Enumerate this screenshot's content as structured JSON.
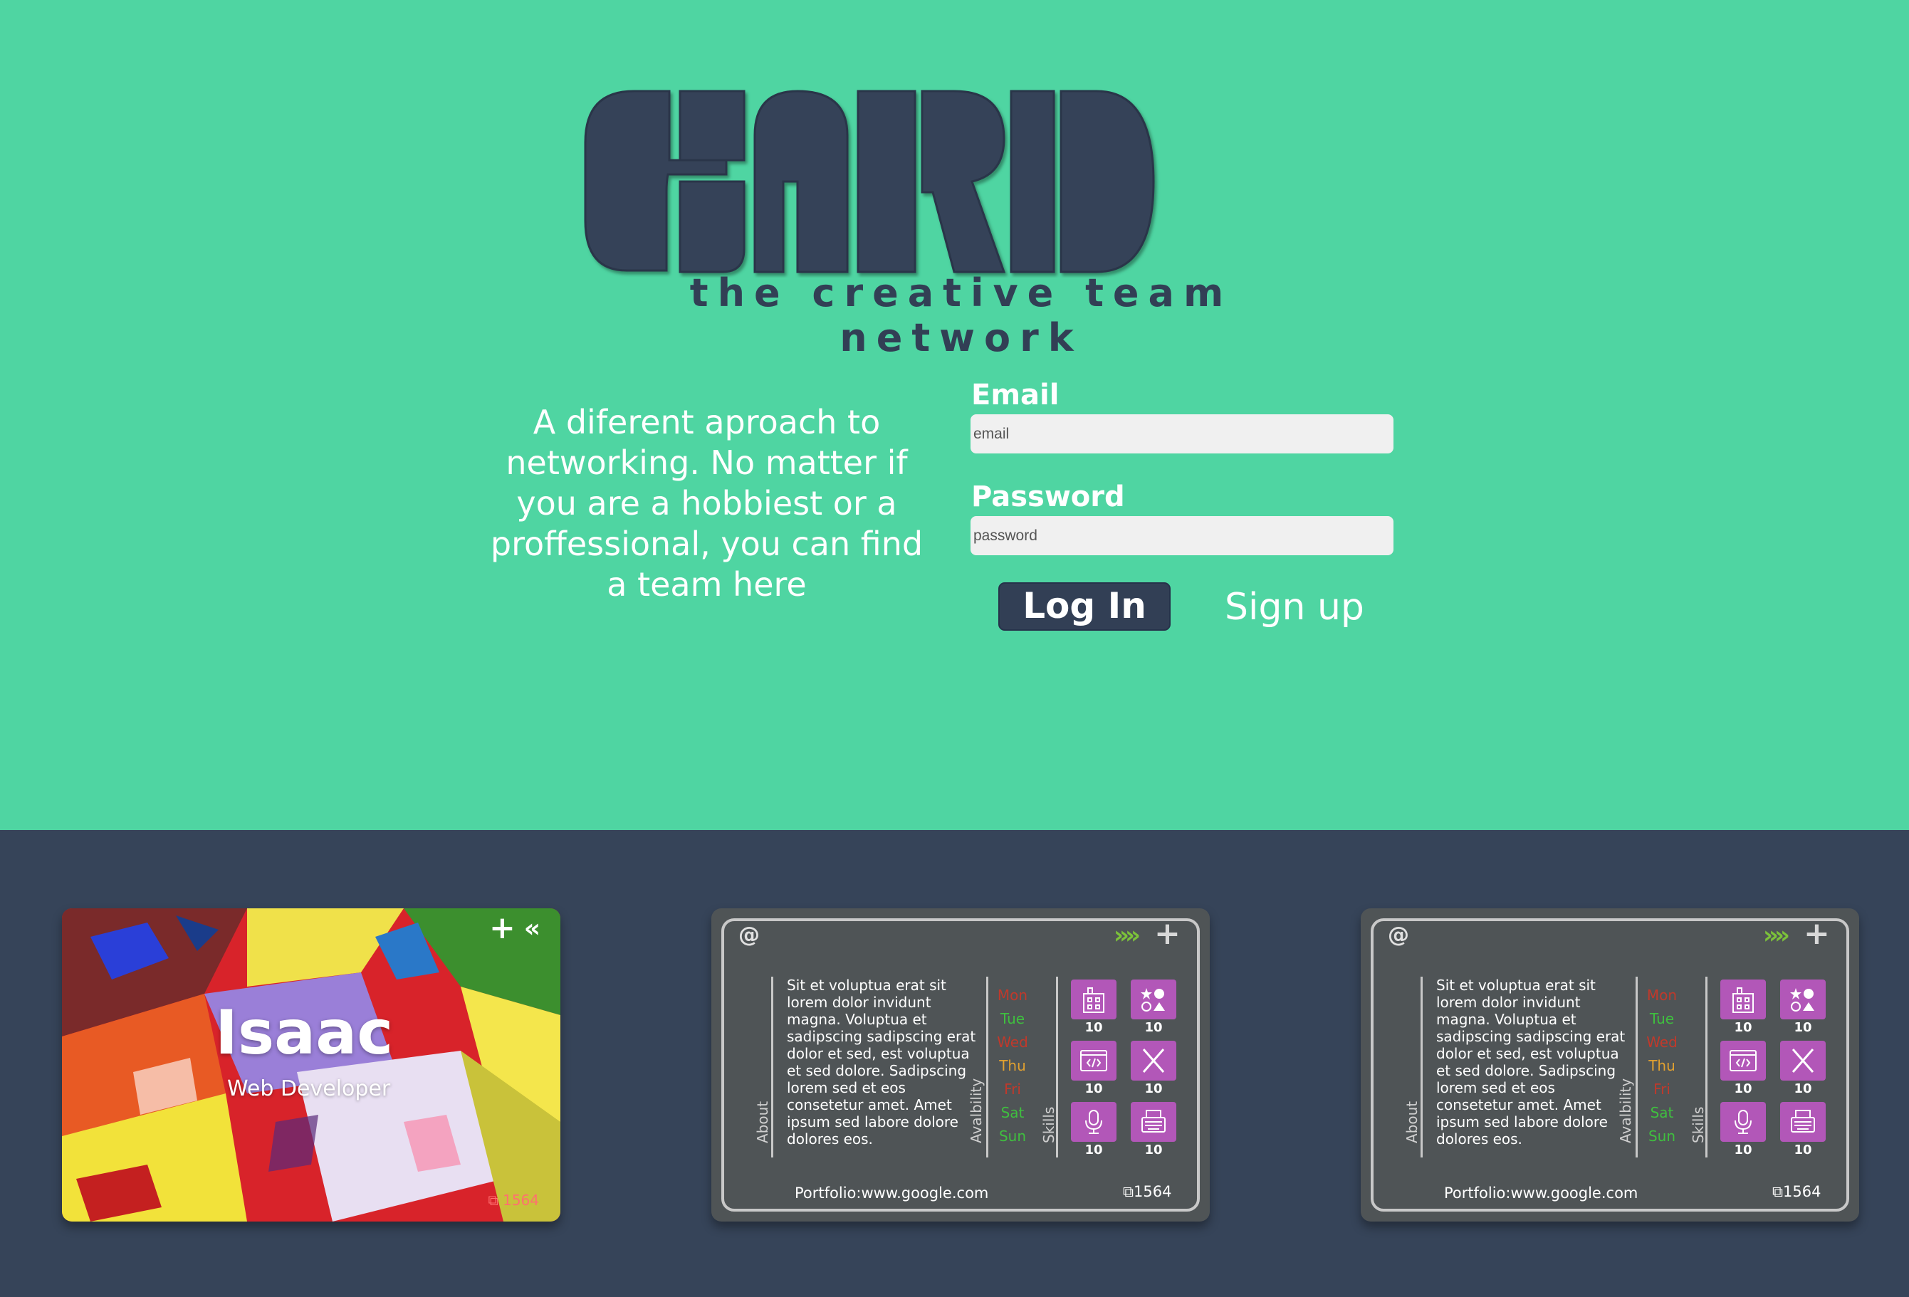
{
  "brand": {
    "logo_text": "CARD",
    "tagline": "the creative team network"
  },
  "intro": {
    "text": "A diferent aproach to networking. No matter if you are a hobbiest or a proffessional, you can find a team here"
  },
  "login": {
    "email_label": "Email",
    "email_placeholder": "email",
    "password_label": "Password",
    "password_placeholder": "password",
    "login_button": "Log In",
    "signup_link": "Sign up"
  },
  "colors": {
    "mint": "#4fd5a2",
    "navy": "#323f55",
    "card_back": "#4f5456",
    "skill_purple": "#b257b8",
    "arrow_green": "#7cc23a"
  },
  "front_card": {
    "name": "Isaac",
    "role": "Web Developer",
    "count": "1564",
    "icons": [
      "chevrons-left-icon",
      "plus-icon"
    ]
  },
  "back_cards": [
    {
      "at_symbol": "@",
      "about_label": "About",
      "about_text": "Sit et voluptua erat sit lorem dolor invidunt magna. Voluptua et sadipscing sadipscing erat dolor et sed, est voluptua et sed dolore. Sadipscing lorem sed et eos consetetur amet. Amet ipsum sed labore dolore dolores eos.",
      "availability_label": "Avalbility",
      "days": [
        {
          "label": "Mon",
          "color": "#c0392b"
        },
        {
          "label": "Tue",
          "color": "#3fbf3f"
        },
        {
          "label": "Wed",
          "color": "#c0392b"
        },
        {
          "label": "Thu",
          "color": "#e0a030"
        },
        {
          "label": "Fri",
          "color": "#c0392b"
        },
        {
          "label": "Sat",
          "color": "#3fbf3f"
        },
        {
          "label": "Sun",
          "color": "#3fbf3f"
        }
      ],
      "skills_label": "Skills",
      "skills": [
        {
          "icon": "building-icon",
          "value": "10"
        },
        {
          "icon": "shapes-icon",
          "value": "10"
        },
        {
          "icon": "code-window-icon",
          "value": "10"
        },
        {
          "icon": "crossed-tools-icon",
          "value": "10"
        },
        {
          "icon": "microphone-icon",
          "value": "10"
        },
        {
          "icon": "typewriter-icon",
          "value": "10"
        }
      ],
      "portfolio": "Portfolio:www.google.com",
      "count": "1564"
    },
    {
      "at_symbol": "@",
      "about_label": "About",
      "about_text": "Sit et voluptua erat sit lorem dolor invidunt magna. Voluptua et sadipscing sadipscing erat dolor et sed, est voluptua et sed dolore. Sadipscing lorem sed et eos consetetur amet. Amet ipsum sed labore dolore dolores eos.",
      "availability_label": "Avalbility",
      "days": [
        {
          "label": "Mon",
          "color": "#c0392b"
        },
        {
          "label": "Tue",
          "color": "#3fbf3f"
        },
        {
          "label": "Wed",
          "color": "#c0392b"
        },
        {
          "label": "Thu",
          "color": "#e0a030"
        },
        {
          "label": "Fri",
          "color": "#c0392b"
        },
        {
          "label": "Sat",
          "color": "#3fbf3f"
        },
        {
          "label": "Sun",
          "color": "#3fbf3f"
        }
      ],
      "skills_label": "Skills",
      "skills": [
        {
          "icon": "building-icon",
          "value": "10"
        },
        {
          "icon": "shapes-icon",
          "value": "10"
        },
        {
          "icon": "code-window-icon",
          "value": "10"
        },
        {
          "icon": "crossed-tools-icon",
          "value": "10"
        },
        {
          "icon": "microphone-icon",
          "value": "10"
        },
        {
          "icon": "typewriter-icon",
          "value": "10"
        }
      ],
      "portfolio": "Portfolio:www.google.com",
      "count": "1564"
    }
  ]
}
